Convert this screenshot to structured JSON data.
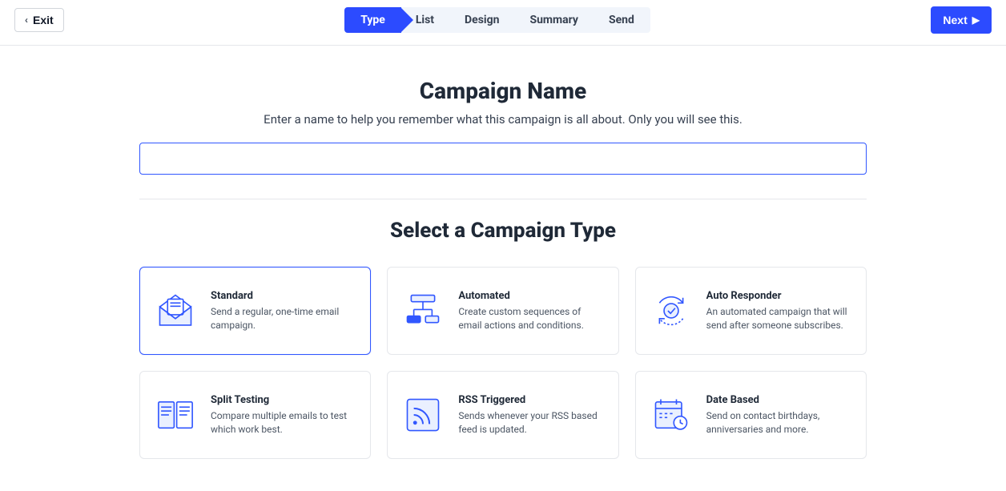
{
  "topbar": {
    "exit_label": "Exit",
    "next_label": "Next"
  },
  "stepper": {
    "steps": [
      "Type",
      "List",
      "Design",
      "Summary",
      "Send"
    ],
    "active_index": 0
  },
  "campaign_name": {
    "heading": "Campaign Name",
    "subtitle": "Enter a name to help you remember what this campaign is all about. Only you will see this.",
    "value": ""
  },
  "type_section": {
    "heading": "Select a Campaign Type",
    "selected_index": 0,
    "cards": [
      {
        "title": "Standard",
        "desc": "Send a regular, one-time email campaign."
      },
      {
        "title": "Automated",
        "desc": "Create custom sequences of email actions and conditions."
      },
      {
        "title": "Auto Responder",
        "desc": "An automated campaign that will send after someone subscribes."
      },
      {
        "title": "Split Testing",
        "desc": "Compare multiple emails to test which work best."
      },
      {
        "title": "RSS Triggered",
        "desc": "Sends whenever your RSS based feed is updated."
      },
      {
        "title": "Date Based",
        "desc": "Send on contact birthdays, anniversaries and more."
      }
    ]
  }
}
